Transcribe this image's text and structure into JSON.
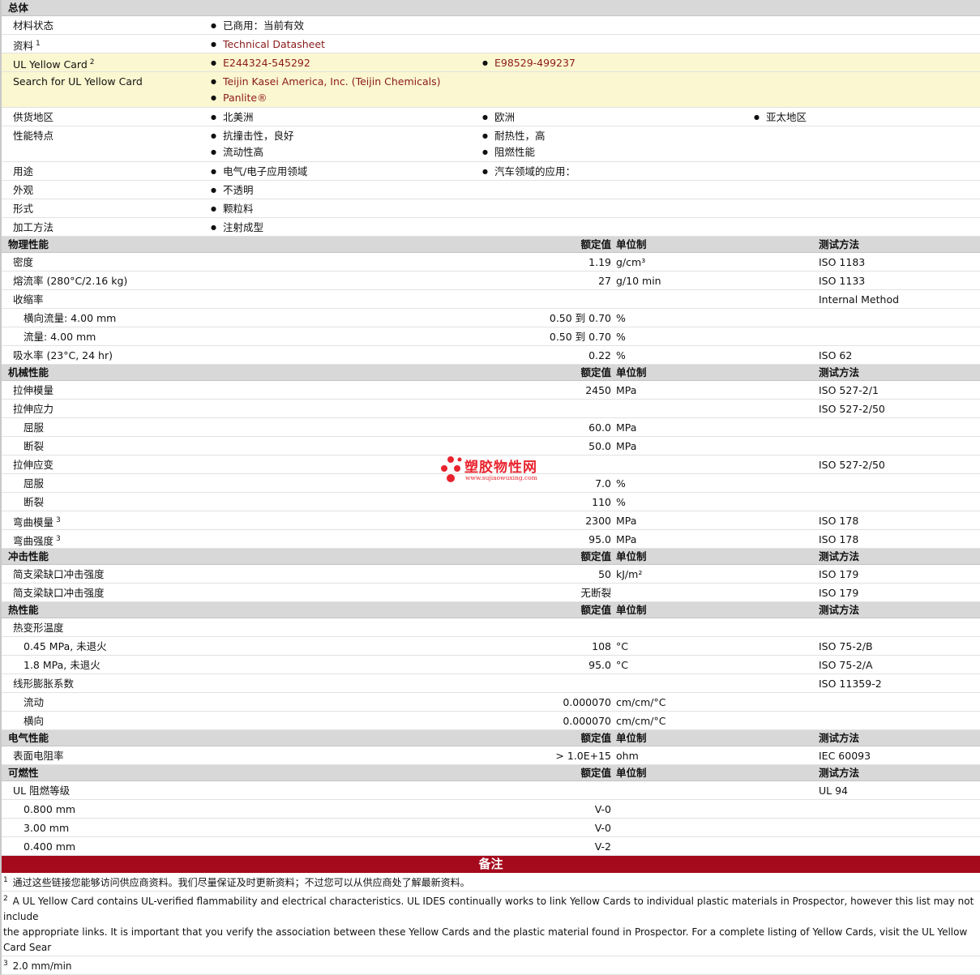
{
  "general": {
    "title": "总体",
    "status_label": "材料状态",
    "status_value": "已商用：当前有效",
    "datasheet_label": "资料",
    "datasheet_sup": "1",
    "datasheet_link": "Technical Datasheet",
    "ul_label": "UL Yellow Card",
    "ul_sup": "2",
    "ul_link1": "E244324-545292",
    "ul_link2": "E98529-499237",
    "search_label": "Search for UL Yellow Card",
    "search_link1": "Teijin Kasei America, Inc. (Teijin Chemicals)",
    "search_link2": "Panlite®",
    "region_label": "供货地区",
    "region1": "北美洲",
    "region2": "欧洲",
    "region3": "亚太地区",
    "features_label": "性能特点",
    "feature1": "抗撞击性，良好",
    "feature2": "耐热性，高",
    "feature3": "流动性高",
    "feature4": "阻燃性能",
    "uses_label": "用途",
    "use1": "电气/电子应用领域",
    "use2": "汽车领域的应用：",
    "appearance_label": "外观",
    "appearance": "不透明",
    "form_label": "形式",
    "form": "颗粒料",
    "process_label": "加工方法",
    "process": "注射成型"
  },
  "headers": {
    "value": "额定值",
    "unit": "单位制",
    "method": "测试方法"
  },
  "physical": {
    "title": "物理性能",
    "rows": [
      {
        "label": "密度",
        "value": "1.19",
        "unit": "g/cm³",
        "method": "ISO 1183"
      },
      {
        "label": "熔流率  (280°C/2.16 kg)",
        "value": "27",
        "unit": "g/10 min",
        "method": "ISO 1133"
      },
      {
        "label": "收缩率",
        "value": "",
        "unit": "",
        "method": "Internal Method"
      },
      {
        "label": "横向流量: 4.00 mm",
        "value": "0.50 到  0.70",
        "unit": "%",
        "method": ""
      },
      {
        "label": "流量: 4.00 mm",
        "value": "0.50 到  0.70",
        "unit": "%",
        "method": ""
      },
      {
        "label": "吸水率  (23°C, 24 hr)",
        "value": "0.22",
        "unit": "%",
        "method": "ISO 62"
      }
    ]
  },
  "mechanical": {
    "title": "机械性能",
    "rows": [
      {
        "label": "拉伸模量",
        "value": "2450",
        "unit": "MPa",
        "method": "ISO 527-2/1"
      },
      {
        "label": "拉伸应力",
        "value": "",
        "unit": "",
        "method": "ISO 527-2/50"
      },
      {
        "label": "屈服",
        "value": "60.0",
        "unit": "MPa",
        "method": ""
      },
      {
        "label": "断裂",
        "value": "50.0",
        "unit": "MPa",
        "method": ""
      },
      {
        "label": "拉伸应变",
        "value": "",
        "unit": "",
        "method": "ISO 527-2/50"
      },
      {
        "label": "屈服",
        "value": "7.0",
        "unit": "%",
        "method": ""
      },
      {
        "label": "断裂",
        "value": "110",
        "unit": "%",
        "method": ""
      },
      {
        "label": "弯曲模量",
        "sup": "3",
        "value": "2300",
        "unit": "MPa",
        "method": "ISO 178"
      },
      {
        "label": "弯曲强度",
        "sup": "3",
        "value": "95.0",
        "unit": "MPa",
        "method": "ISO 178"
      }
    ]
  },
  "impact": {
    "title": "冲击性能",
    "rows": [
      {
        "label": "简支梁缺口冲击强度",
        "value": "50",
        "unit": "kJ/m²",
        "method": "ISO 179"
      },
      {
        "label": "简支梁缺口冲击强度",
        "value": "无断裂",
        "unit": "",
        "method": "ISO 179"
      }
    ]
  },
  "thermal": {
    "title": "热性能",
    "rows": [
      {
        "label": "热变形温度",
        "value": "",
        "unit": "",
        "method": ""
      },
      {
        "label": "0.45 MPa, 未退火",
        "value": "108",
        "unit": "°C",
        "method": "ISO 75-2/B"
      },
      {
        "label": "1.8 MPa, 未退火",
        "value": "95.0",
        "unit": "°C",
        "method": "ISO 75-2/A"
      },
      {
        "label": "线形膨胀系数",
        "value": "",
        "unit": "",
        "method": "ISO 11359-2"
      },
      {
        "label": "流动",
        "value": "0.000070",
        "unit": "cm/cm/°C",
        "method": ""
      },
      {
        "label": "横向",
        "value": "0.000070",
        "unit": "cm/cm/°C",
        "method": ""
      }
    ]
  },
  "electrical": {
    "title": "电气性能",
    "rows": [
      {
        "label": "表面电阻率",
        "value": "> 1.0E+15",
        "unit": "ohm",
        "method": "IEC 60093"
      }
    ]
  },
  "flammability": {
    "title": "可燃性",
    "rows": [
      {
        "label": "UL 阻燃等级",
        "value": "",
        "unit": "",
        "method": "UL 94"
      },
      {
        "label": "0.800 mm",
        "value": "V-0",
        "unit": "",
        "method": ""
      },
      {
        "label": "3.00 mm",
        "value": "V-0",
        "unit": "",
        "method": ""
      },
      {
        "label": "0.400 mm",
        "value": "V-2",
        "unit": "",
        "method": ""
      }
    ]
  },
  "notes": {
    "title": "备注",
    "n1_sup": "1",
    "n1": "通过这些链接您能够访问供应商资料。我们尽量保证及时更新资料；不过您可以从供应商处了解最新资料。",
    "n2_sup": "2",
    "n2a": "A UL Yellow Card contains UL-verified flammability and electrical characteristics. UL IDES continually works to link Yellow Cards to individual plastic materials in Prospector, however this list may not include",
    "n2b": "the appropriate links. It is important that you verify the association between these Yellow Cards and the plastic material found in Prospector. For a complete listing of Yellow Cards, visit the UL Yellow Card Sear",
    "n3_sup": "3",
    "n3": "2.0 mm/min"
  },
  "watermark": {
    "text": "塑胶物性网",
    "url": "www.sujiaowuxing.com"
  }
}
